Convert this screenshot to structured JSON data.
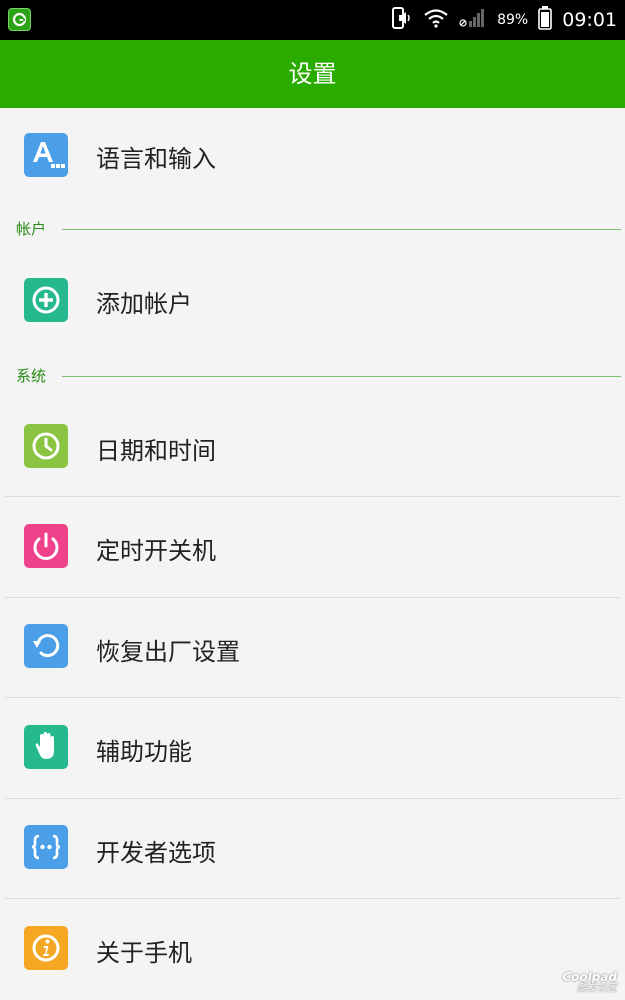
{
  "status_bar": {
    "battery_percent": "89%",
    "time": "09:01",
    "icons": [
      "phone-sound-icon",
      "wifi-icon",
      "no-sim-signal-icon",
      "battery-icon"
    ]
  },
  "header": {
    "title": "设置"
  },
  "sections": {
    "account": "帐户",
    "system": "系统"
  },
  "items": {
    "language": {
      "label": "语言和输入",
      "icon": "language-icon",
      "color": "#4a9fe8"
    },
    "add_account": {
      "label": "添加帐户",
      "icon": "add-circle-icon",
      "color": "#27b98e"
    },
    "date_time": {
      "label": "日期和时间",
      "icon": "clock-icon",
      "color": "#8ac441"
    },
    "power_schedule": {
      "label": "定时开关机",
      "icon": "power-icon",
      "color": "#f0428a"
    },
    "factory_reset": {
      "label": "恢复出厂设置",
      "icon": "restore-icon",
      "color": "#4a9fe8"
    },
    "accessibility": {
      "label": "辅助功能",
      "icon": "hand-icon",
      "color": "#27b98e"
    },
    "developer": {
      "label": "开发者选项",
      "icon": "braces-icon",
      "color": "#4a9fe8"
    },
    "about": {
      "label": "关于手机",
      "icon": "info-icon",
      "color": "#f5a623"
    }
  },
  "watermark": {
    "line1": "Coolpad",
    "line2": "酷友社区"
  }
}
